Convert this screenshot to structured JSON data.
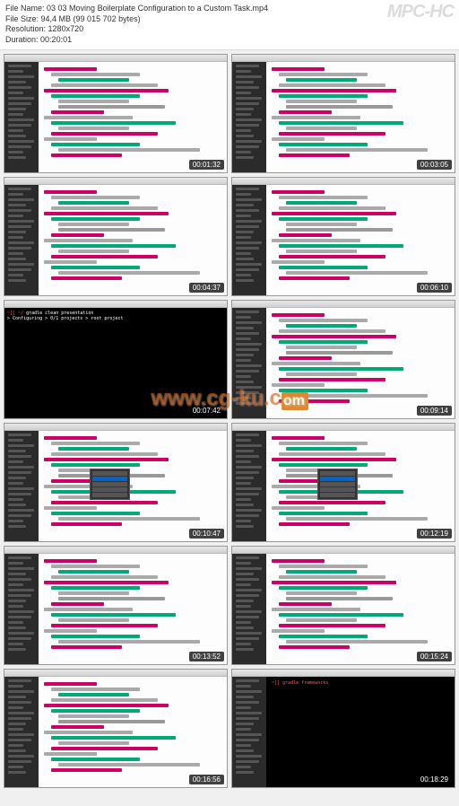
{
  "player_name": "MPC-HC",
  "file_info": {
    "name_label": "File Name:",
    "name": "03 03 Moving Boilerplate Configuration to a Custom Task.mp4",
    "size_label": "File Size:",
    "size": "94,4 MB (99 015 702 bytes)",
    "resolution_label": "Resolution:",
    "resolution": "1280x720",
    "duration_label": "Duration:",
    "duration": "00:20:01"
  },
  "watermark": "www.cg-ku.com",
  "thumbnails": [
    {
      "timestamp": "00:01:32",
      "editor_theme": "light"
    },
    {
      "timestamp": "00:03:05",
      "editor_theme": "light"
    },
    {
      "timestamp": "00:04:37",
      "editor_theme": "light"
    },
    {
      "timestamp": "00:06:10",
      "editor_theme": "light"
    },
    {
      "timestamp": "00:07:42",
      "editor_theme": "terminal",
      "terminal_text": "Configuring > 0/1 projects > root project"
    },
    {
      "timestamp": "00:09:14",
      "editor_theme": "light"
    },
    {
      "timestamp": "00:10:47",
      "editor_theme": "light",
      "has_autocomplete": true
    },
    {
      "timestamp": "00:12:19",
      "editor_theme": "light",
      "has_autocomplete": true
    },
    {
      "timestamp": "00:13:52",
      "editor_theme": "light"
    },
    {
      "timestamp": "00:15:24",
      "editor_theme": "light"
    },
    {
      "timestamp": "00:16:56",
      "editor_theme": "light"
    },
    {
      "timestamp": "00:18:29",
      "editor_theme": "terminal_only"
    }
  ]
}
